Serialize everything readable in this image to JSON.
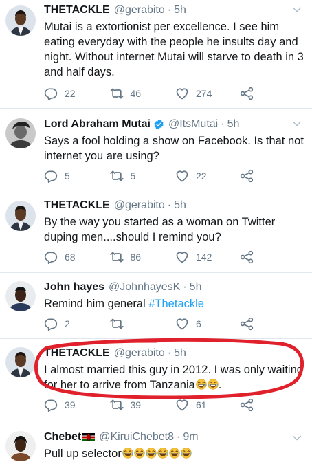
{
  "tweets": [
    {
      "name": "THETACKLE",
      "handle": "@gerabito",
      "time": "5h",
      "text": "Mutai is a extortionist per excellence. I see him eating everyday with the people he insults day and night. Without internet Mutai will starve to death in 3 and half days.",
      "replies": "22",
      "retweets": "46",
      "likes": "274"
    },
    {
      "name": "Lord Abraham Mutai",
      "handle": "@ItsMutai",
      "time": "5h",
      "text": "Says a fool holding a show on Facebook. Is that not internet you are using?",
      "replies": "5",
      "retweets": "5",
      "likes": "22"
    },
    {
      "name": "THETACKLE",
      "handle": "@gerabito",
      "time": "5h",
      "text": "By the way you started as a woman on Twitter duping men....should I remind you?",
      "replies": "68",
      "retweets": "86",
      "likes": "142"
    },
    {
      "name": "John hayes",
      "handle": "@JohnhayesK",
      "time": "5h",
      "text_prefix": "Remind him general ",
      "hashtag": "#Thetackle",
      "replies": "2",
      "retweets": "",
      "likes": "6"
    },
    {
      "name": "THETACKLE",
      "handle": "@gerabito",
      "time": "5h",
      "text_line1": "I almost married this guy in 2012. I was only waiting",
      "text_line2": "for her to arrive from Tanzania",
      "text_suffix": ".",
      "replies": "39",
      "retweets": "39",
      "likes": "61"
    },
    {
      "name": "Chebet",
      "handle": "@KiruiChebet8",
      "time": "9m",
      "text": "Pull up selector"
    }
  ],
  "icons": {
    "reply": "reply-icon",
    "retweet": "retweet-icon",
    "like": "like-icon",
    "share": "share-icon",
    "verified": "verified-icon",
    "chevron": "chevron-down-icon",
    "emoji": "laughing-emoji-icon",
    "flag": "kenya-flag-icon"
  },
  "colors": {
    "accent": "#1da1f2",
    "muted": "#657786",
    "annotation": "#e0202a"
  }
}
